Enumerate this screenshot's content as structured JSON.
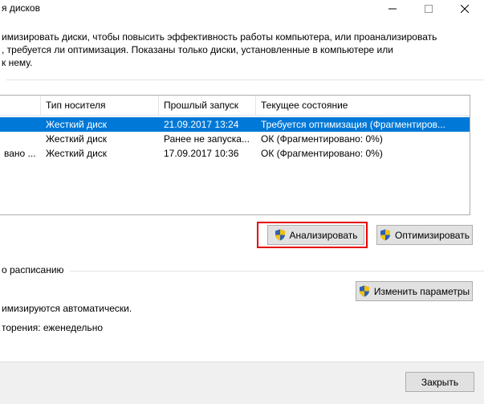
{
  "window": {
    "title": "я дисков"
  },
  "description": "имизировать диски, чтобы повысить эффективность работы  компьютера, или проанализировать\n, требуется ли оптимизация. Показаны только диски, установленные в компьютере или\nк нему.",
  "table": {
    "columns": [
      "Тип носителя",
      "Прошлый запуск",
      "Текущее состояние"
    ],
    "rows": [
      {
        "name": "",
        "media": "Жесткий диск",
        "last_run": "21.09.2017 13:24",
        "status": "Требуется оптимизация (Фрагментиров...",
        "selected": true
      },
      {
        "name": "",
        "media": "Жесткий диск",
        "last_run": "Ранее не запуска...",
        "status": "ОК (Фрагментировано: 0%)",
        "selected": false
      },
      {
        "name": "вано ...",
        "media": "Жесткий диск",
        "last_run": "17.09.2017 10:36",
        "status": "ОК (Фрагментировано: 0%)",
        "selected": false
      }
    ]
  },
  "buttons": {
    "analyze": "Анализировать",
    "optimize": "Оптимизировать",
    "change_settings": "Изменить параметры",
    "close": "Закрыть"
  },
  "schedule": {
    "section_label": "о расписанию",
    "auto_text": "имизируются автоматически.",
    "frequency_text": "торения: еженедельно"
  },
  "colors": {
    "selection": "#0078d7",
    "highlight_box": "#e60000",
    "shield_blue": "#2d5fb3",
    "shield_yellow": "#f3c10a"
  },
  "icons": {
    "uac_shield": "uac-shield-icon",
    "minimize": "minimize-icon",
    "maximize": "maximize-icon",
    "close": "close-icon"
  }
}
